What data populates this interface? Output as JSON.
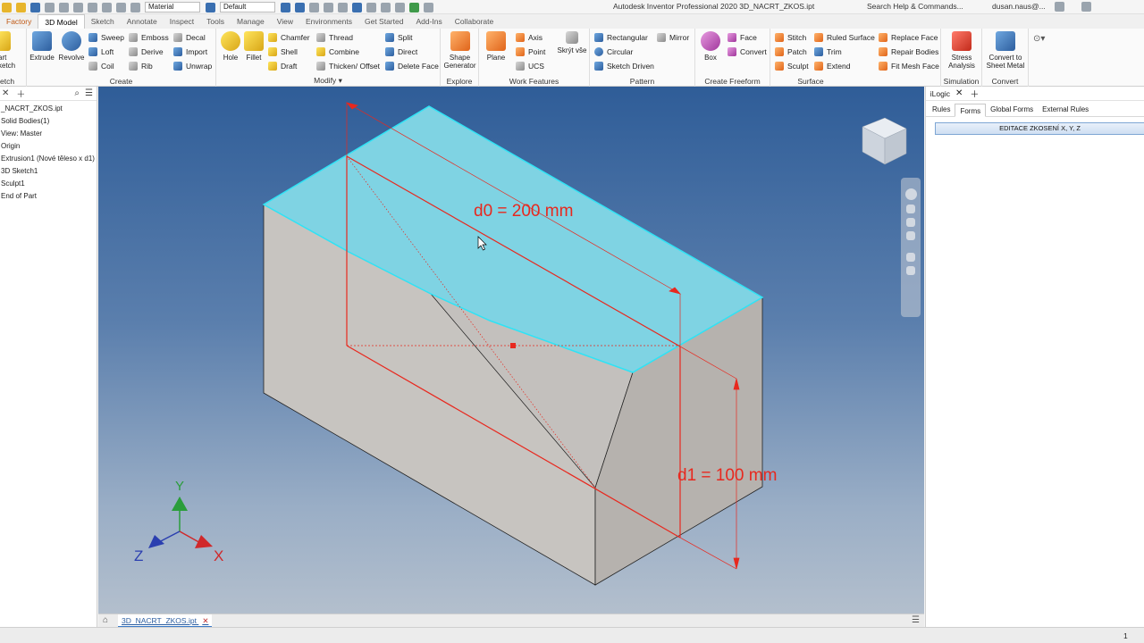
{
  "window": {
    "title": "Autodesk Inventor Professional 2020   3D_NACRT_ZKOS.ipt",
    "search_placeholder": "Search Help & Commands...",
    "user": "dusan.naus@...",
    "material_select": "Material",
    "appearance_select": "Default"
  },
  "tabs": [
    {
      "label": "Factory"
    },
    {
      "label": "3D Model"
    },
    {
      "label": "Sketch"
    },
    {
      "label": "Annotate"
    },
    {
      "label": "Inspect"
    },
    {
      "label": "Tools"
    },
    {
      "label": "Manage"
    },
    {
      "label": "View"
    },
    {
      "label": "Environments"
    },
    {
      "label": "Get Started"
    },
    {
      "label": "Add-Ins"
    },
    {
      "label": "Collaborate"
    }
  ],
  "ribbon": {
    "sketch": {
      "line1": "art",
      "line2": "ketch",
      "title": "etch"
    },
    "create": {
      "title": "Create",
      "extrude": "Extrude",
      "revolve": "Revolve",
      "sweep": "Sweep",
      "loft": "Loft",
      "coil": "Coil",
      "emboss": "Emboss",
      "derive": "Derive",
      "rib": "Rib",
      "decal": "Decal",
      "import": "Import",
      "unwrap": "Unwrap"
    },
    "modify": {
      "title": "Modify",
      "hole": "Hole",
      "fillet": "Fillet",
      "chamfer": "Chamfer",
      "shell": "Shell",
      "draft": "Draft",
      "thread": "Thread",
      "combine": "Combine",
      "thicken": "Thicken/ Offset",
      "split": "Split",
      "direct": "Direct",
      "delete_face": "Delete Face"
    },
    "explore": {
      "title": "Explore",
      "shape_gen_1": "Shape",
      "shape_gen_2": "Generator"
    },
    "work": {
      "title": "Work Features",
      "plane": "Plane",
      "axis": "Axis",
      "point": "Point",
      "ucs": "UCS",
      "hide_all": "Skrýt vše"
    },
    "pattern": {
      "title": "Pattern",
      "rectangular": "Rectangular",
      "circular": "Circular",
      "sketch_driven": "Sketch Driven",
      "mirror": "Mirror"
    },
    "freeform": {
      "title": "Create Freeform",
      "box": "Box",
      "face": "Face",
      "convert": "Convert"
    },
    "surface": {
      "title": "Surface",
      "stitch": "Stitch",
      "patch": "Patch",
      "sculpt": "Sculpt",
      "ruled": "Ruled Surface",
      "trim": "Trim",
      "extend": "Extend",
      "replace_face": "Replace Face",
      "repair": "Repair Bodies",
      "fit_mesh": "Fit Mesh Face"
    },
    "simulation": {
      "title": "Simulation",
      "line1": "Stress",
      "line2": "Analysis"
    },
    "convert": {
      "title": "Convert",
      "line1": "Convert to",
      "line2": "Sheet Metal"
    }
  },
  "browser": {
    "items": [
      "_NACRT_ZKOS.ipt",
      "Solid Bodies(1)",
      "View: Master",
      "Origin",
      "Extrusion1 (Nové těleso x d1)",
      "3D Sketch1",
      "Sculpt1",
      "End of Part"
    ]
  },
  "viewport": {
    "dim_d0": "d0 = 200 mm",
    "dim_d1": "d1 = 100 mm",
    "axis_x": "X",
    "axis_y": "Y",
    "axis_z": "Z",
    "sketch_color": "#e8281e",
    "face_color": "#7fd3e3"
  },
  "document_tab": "3D_NACRT_ZKOS.ipt",
  "logic": {
    "title": "iLogic",
    "tabs": [
      "Rules",
      "Forms",
      "Global Forms",
      "External Rules"
    ],
    "active_tab": "Forms",
    "form_button": "EDITACE ZKOSENÍ X, Y, Z"
  },
  "status": {
    "page": "1"
  }
}
